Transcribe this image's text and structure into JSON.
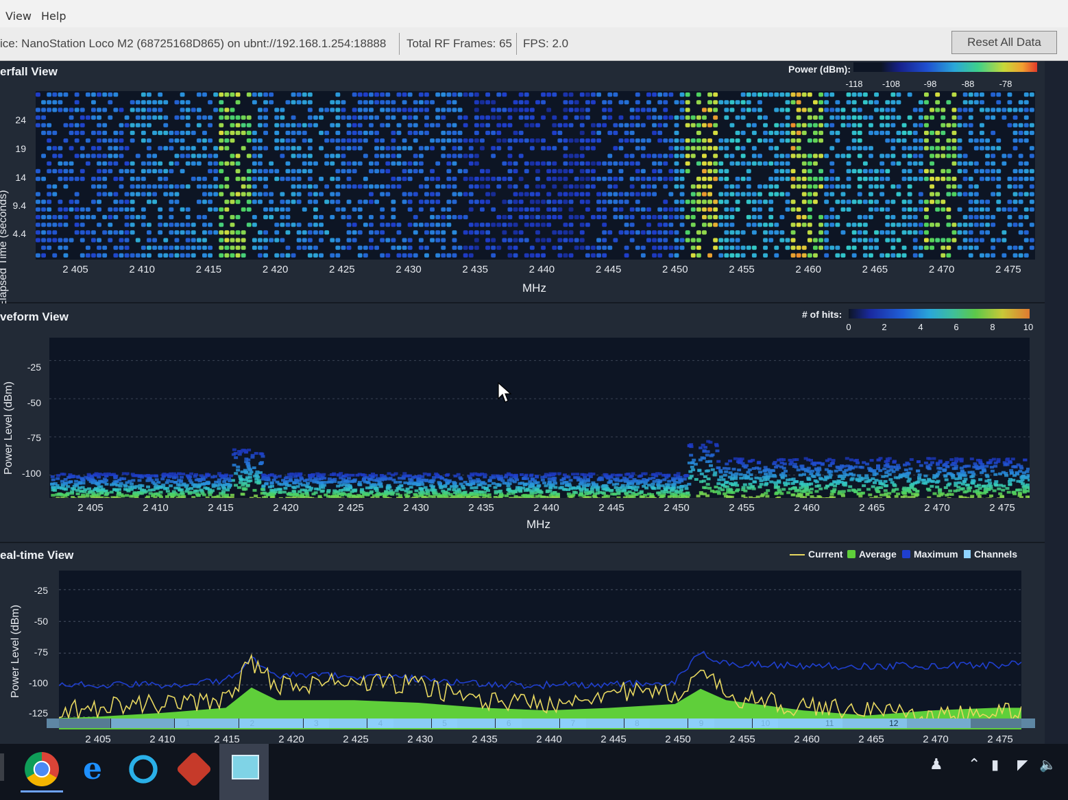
{
  "menu": {
    "view": "View",
    "help": "Help"
  },
  "status": {
    "device": "ice: NanoStation Loco M2 (68725168D865) on ubnt://192.168.1.254:18888",
    "frames": "Total RF Frames: 65",
    "fps": "FPS: 2.0",
    "reset": "Reset All Data"
  },
  "waterfall": {
    "title": "erfall View",
    "ylabel": "Elapsed Time (seconds)",
    "yticks": [
      "24",
      "19",
      "14",
      "9.4",
      "4.4"
    ],
    "xticks": [
      "2 405",
      "2 410",
      "2 415",
      "2 420",
      "2 425",
      "2 430",
      "2 435",
      "2 440",
      "2 445",
      "2 450",
      "2 455",
      "2 460",
      "2 465",
      "2 470",
      "2 475"
    ],
    "xlabel": "MHz",
    "legend_title": "Power (dBm):",
    "legend_ticks": [
      "-118",
      "-108",
      "-98",
      "-88",
      "-78"
    ]
  },
  "waveform": {
    "title": "veform View",
    "ylabel": "Power Level (dBm)",
    "yticks": [
      "-25",
      "-50",
      "-75",
      "-100"
    ],
    "xticks": [
      "2 405",
      "2 410",
      "2 415",
      "2 420",
      "2 425",
      "2 430",
      "2 435",
      "2 440",
      "2 445",
      "2 450",
      "2 455",
      "2 460",
      "2 465",
      "2 470",
      "2 475"
    ],
    "xlabel": "MHz",
    "legend_title": "# of hits:",
    "legend_ticks": [
      "0",
      "2",
      "4",
      "6",
      "8",
      "10"
    ]
  },
  "realtime": {
    "title": "eal-time View",
    "ylabel": "Power Level (dBm)",
    "yticks": [
      "-25",
      "-50",
      "-75",
      "-100",
      "-125"
    ],
    "xticks": [
      "2 405",
      "2 410",
      "2 415",
      "2 420",
      "2 425",
      "2 430",
      "2 435",
      "2 440",
      "2 445",
      "2 450",
      "2 455",
      "2 460",
      "2 465",
      "2 470",
      "2 475"
    ],
    "legend": {
      "current": "Current",
      "average": "Average",
      "maximum": "Maximum",
      "channels": "Channels"
    },
    "channels": [
      "1",
      "2",
      "3",
      "4",
      "5",
      "6",
      "7",
      "8",
      "9",
      "10",
      "11",
      "12"
    ],
    "colors": {
      "current": "#e8d860",
      "average": "#5fcf3a",
      "maximum": "#1f3fcf",
      "channels": "#8fd3ff"
    }
  },
  "chart_data": [
    {
      "type": "heatmap",
      "title": "erfall View",
      "xlabel": "MHz",
      "ylabel": "Elapsed Time (seconds)",
      "xlim": [
        2402,
        2477
      ],
      "y_ticks": [
        24,
        19,
        14,
        9.4,
        4.4
      ],
      "hotspots_mhz": [
        2417,
        2452,
        2460,
        2470
      ],
      "legend": "Power (dBm) -118 to -78"
    },
    {
      "type": "heatmap",
      "title": "veform View",
      "xlabel": "MHz",
      "ylabel": "Power Level (dBm)",
      "xlim": [
        2402,
        2477
      ],
      "ylim": [
        -115,
        -10
      ],
      "peaks": [
        {
          "x": 2417,
          "y": -82
        },
        {
          "x": 2452,
          "y": -77
        }
      ]
    },
    {
      "type": "line",
      "title": "eal-time View",
      "ylabel": "Power Level (dBm)",
      "xlim": [
        2402,
        2477
      ],
      "ylim": [
        -135,
        -10
      ],
      "x": [
        2402,
        2405,
        2410,
        2415,
        2417,
        2419,
        2425,
        2430,
        2435,
        2440,
        2445,
        2450,
        2452,
        2454,
        2460,
        2465,
        2470,
        2475,
        2477
      ],
      "series": [
        {
          "name": "Current",
          "values": [
            -120,
            -118,
            -115,
            -112,
            -82,
            -100,
            -98,
            -100,
            -112,
            -115,
            -105,
            -108,
            -90,
            -108,
            -118,
            -118,
            -125,
            -122,
            -120
          ]
        },
        {
          "name": "Average",
          "values": [
            -126,
            -125,
            -122,
            -118,
            -102,
            -112,
            -112,
            -114,
            -118,
            -120,
            -118,
            -115,
            -103,
            -112,
            -120,
            -124,
            -120,
            -118,
            -118
          ]
        },
        {
          "name": "Maximum",
          "values": [
            -100,
            -100,
            -100,
            -97,
            -80,
            -92,
            -93,
            -95,
            -100,
            -100,
            -100,
            -98,
            -75,
            -83,
            -85,
            -85,
            -85,
            -84,
            -84
          ]
        }
      ]
    }
  ]
}
